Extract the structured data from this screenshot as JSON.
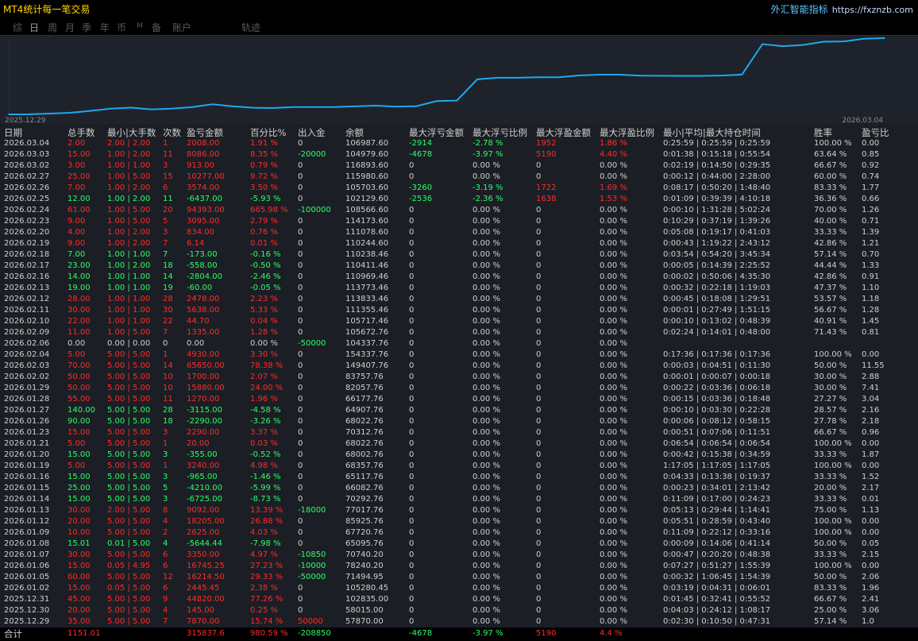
{
  "app": {
    "title": "MT4统计每一笔交易",
    "brand": "外汇智能指标",
    "url": "https://fxznzb.com"
  },
  "tabs": [
    {
      "id": "zong",
      "label": "综",
      "active": false
    },
    {
      "id": "ri",
      "label": "日",
      "active": true
    },
    {
      "id": "zhou",
      "label": "周",
      "active": false
    },
    {
      "id": "yue",
      "label": "月",
      "active": false
    },
    {
      "id": "ji",
      "label": "季",
      "active": false
    },
    {
      "id": "nian",
      "label": "年",
      "active": false
    },
    {
      "id": "bi",
      "label": "币",
      "active": false
    },
    {
      "id": "m",
      "label": "M",
      "active": false,
      "small": true
    },
    {
      "id": "bei",
      "label": "备",
      "active": false
    },
    {
      "id": "zhanghu",
      "label": "账户",
      "active": false
    },
    {
      "id": "guiji",
      "label": "轨迹",
      "active": false
    }
  ],
  "colors": {
    "up": "#2bff6a",
    "down": "#ff2b2b",
    "neutral": "#d0d0d0",
    "line": "#1ea8ef",
    "chart_bg": "#1e222a"
  },
  "chart_data": {
    "type": "line",
    "x_start": "2025.12.29",
    "x_end": "2026.03.04",
    "x": [
      "2025.12.29",
      "2025.12.30",
      "2025.12.31",
      "2026.01.02",
      "2026.01.05",
      "2026.01.06",
      "2026.01.07",
      "2026.01.08",
      "2026.01.09",
      "2026.01.12",
      "2026.01.13",
      "2026.01.14",
      "2026.01.15",
      "2026.01.16",
      "2026.01.19",
      "2026.01.20",
      "2026.01.21",
      "2026.01.23",
      "2026.01.26",
      "2026.01.27",
      "2026.01.28",
      "2026.01.29",
      "2026.02.02",
      "2026.02.03",
      "2026.02.04",
      "2026.02.06",
      "2026.02.09",
      "2026.02.10",
      "2026.02.11",
      "2026.02.12",
      "2026.02.13",
      "2026.02.16",
      "2026.02.17",
      "2026.02.18",
      "2026.02.19",
      "2026.02.20",
      "2026.02.23",
      "2026.02.24",
      "2026.02.25",
      "2026.02.26",
      "2026.02.27",
      "2026.03.02",
      "2026.03.03",
      "2026.03.04"
    ],
    "values": [
      57870,
      58015,
      102835,
      105280.45,
      71494.95,
      78240.2,
      70740.2,
      65095.76,
      67720.76,
      85925.76,
      77017.76,
      70292.76,
      66082.76,
      65117.76,
      68357.76,
      68002.76,
      68022.76,
      70312.76,
      68022.76,
      64907.76,
      66177.76,
      82057.76,
      83757.76,
      149407.76,
      154337.76,
      104337.76,
      105672.76,
      105717.46,
      111355.46,
      113833.46,
      113773.46,
      110969.46,
      110411.46,
      110238.46,
      110244.6,
      111078.6,
      114173.6,
      108566.6,
      102129.6,
      105703.6,
      115980.6,
      116893.6,
      104979.6,
      106987.6
    ],
    "plot_values": [
      0,
      145,
      2580,
      5025,
      10845,
      17591,
      20941,
      15296,
      17922,
      22422,
      31514,
      24789,
      20579,
      19614,
      22854,
      22499,
      22519,
      24809,
      27099,
      23984,
      25254,
      41134,
      42834,
      108484,
      113414,
      113414,
      114749,
      114794,
      120432,
      122910,
      122850,
      120046,
      119488,
      119315,
      119321,
      120155,
      123250,
      217643,
      211206,
      214780,
      225057,
      225970,
      234006,
      236014
    ],
    "ylim": [
      0,
      236014
    ]
  },
  "columns": [
    "日期",
    "总手数",
    "最小|大手数",
    "次数",
    "盈亏金额",
    "百分比%",
    "出入金",
    "余额",
    "最大浮亏金额",
    "最大浮亏比例",
    "最大浮盈金额",
    "最大浮盈比例",
    "最小|平均|最大持仓时间",
    "胜率",
    "盈亏比"
  ],
  "rows": [
    [
      "2026.03.04",
      "2.00",
      "2.00 | 2.00",
      "1",
      "2008.00",
      "1.91 %",
      "0",
      "106987.60",
      "-2914",
      "-2.78 %",
      "1952",
      "1.86 %",
      "0:25:59 | 0:25:59 | 0:25:59",
      "100.00 %",
      "0.00"
    ],
    [
      "2026.03.03",
      "15.00",
      "1.00 | 2.00",
      "11",
      "8086.00",
      "8.35 %",
      "-20000",
      "104979.60",
      "-4678",
      "-3.97 %",
      "5190",
      "4.40 %",
      "0:01:38 | 0:15:18 | 0:55:54",
      "63.64 %",
      "0.85"
    ],
    [
      "2026.03.02",
      "3.00",
      "1.00 | 1.00",
      "3",
      "913.00",
      "0.79 %",
      "0",
      "116893.60",
      "0",
      "0.00 %",
      "0",
      "0.00 %",
      "0:02:19 | 0:14:50 | 0:29:35",
      "66.67 %",
      "0.92"
    ],
    [
      "2026.02.27",
      "25.00",
      "1.00 | 5.00",
      "15",
      "10277.00",
      "9.72 %",
      "0",
      "115980.60",
      "0",
      "0.00 %",
      "0",
      "0.00 %",
      "0:00:12 | 0:44:00 | 2:28:00",
      "60.00 %",
      "0.74"
    ],
    [
      "2026.02.26",
      "7.00",
      "1.00 | 2.00",
      "6",
      "3574.00",
      "3.50 %",
      "0",
      "105703.60",
      "-3260",
      "-3.19 %",
      "1722",
      "1.69 %",
      "0:08:17 | 0:50:20 | 1:48:40",
      "83.33 %",
      "1.77"
    ],
    [
      "2026.02.25",
      "12.00",
      "1.00 | 2.00",
      "11",
      "-6437.00",
      "-5.93 %",
      "0",
      "102129.60",
      "-2536",
      "-2.36 %",
      "1638",
      "1.53 %",
      "0:01:09 | 0:39:39 | 4:10:18",
      "36.36 %",
      "0.66"
    ],
    [
      "2026.02.24",
      "61.00",
      "1.00 | 5.00",
      "20",
      "94393.00",
      "665.98 %",
      "-100000",
      "108566.60",
      "0",
      "0.00 %",
      "0",
      "0.00 %",
      "0:00:10 | 1:31:28 | 5:02:24",
      "70.00 %",
      "1.26"
    ],
    [
      "2026.02.23",
      "9.00",
      "1.00 | 5.00",
      "5",
      "3095.00",
      "2.79 %",
      "0",
      "114173.60",
      "0",
      "0.00 %",
      "0",
      "0.00 %",
      "0:10:29 | 0:37:19 | 1:39:26",
      "40.00 %",
      "0.71"
    ],
    [
      "2026.02.20",
      "4.00",
      "1.00 | 2.00",
      "3",
      "834.00",
      "0.76 %",
      "0",
      "111078.60",
      "0",
      "0.00 %",
      "0",
      "0.00 %",
      "0:05:08 | 0:19:17 | 0:41:03",
      "33.33 %",
      "1.39"
    ],
    [
      "2026.02.19",
      "9.00",
      "1.00 | 2.00",
      "7",
      "6.14",
      "0.01 %",
      "0",
      "110244.60",
      "0",
      "0.00 %",
      "0",
      "0.00 %",
      "0:00:43 | 1:19:22 | 2:43:12",
      "42.86 %",
      "1.21"
    ],
    [
      "2026.02.18",
      "7.00",
      "1.00 | 1.00",
      "7",
      "-173.00",
      "-0.16 %",
      "0",
      "110238.46",
      "0",
      "0.00 %",
      "0",
      "0.00 %",
      "0:03:54 | 0:54:20 | 3:45:34",
      "57.14 %",
      "0.70"
    ],
    [
      "2026.02.17",
      "23.00",
      "1.00 | 2.00",
      "18",
      "-558.00",
      "-0.50 %",
      "0",
      "110411.46",
      "0",
      "0.00 %",
      "0",
      "0.00 %",
      "0:00:05 | 0:14:39 | 2:25:52",
      "44.44 %",
      "1.33"
    ],
    [
      "2026.02.16",
      "14.00",
      "1.00 | 1.00",
      "14",
      "-2804.00",
      "-2.46 %",
      "0",
      "110969.46",
      "0",
      "0.00 %",
      "0",
      "0.00 %",
      "0:00:02 | 0:50:06 | 4:35:30",
      "42.86 %",
      "0.91"
    ],
    [
      "2026.02.13",
      "19.00",
      "1.00 | 1.00",
      "19",
      "-60.00",
      "-0.05 %",
      "0",
      "113773.46",
      "0",
      "0.00 %",
      "0",
      "0.00 %",
      "0:00:32 | 0:22:18 | 1:19:03",
      "47.37 %",
      "1.10"
    ],
    [
      "2026.02.12",
      "28.00",
      "1.00 | 1.00",
      "28",
      "2478.00",
      "2.23 %",
      "0",
      "113833.46",
      "0",
      "0.00 %",
      "0",
      "0.00 %",
      "0:00:45 | 0:18:08 | 1:29:51",
      "53.57 %",
      "1.18"
    ],
    [
      "2026.02.11",
      "30.00",
      "1.00 | 1.00",
      "30",
      "5638.00",
      "5.33 %",
      "0",
      "111355.46",
      "0",
      "0.00 %",
      "0",
      "0.00 %",
      "0:00:01 | 0:27:49 | 1:51:15",
      "56.67 %",
      "1.28"
    ],
    [
      "2026.02.10",
      "22.00",
      "1.00 | 1.00",
      "22",
      "44.70",
      "0.04 %",
      "0",
      "105717.46",
      "0",
      "0.00 %",
      "0",
      "0.00 %",
      "0:00:10 | 0:13:02 | 0:48:39",
      "40.91 %",
      "1.45"
    ],
    [
      "2026.02.09",
      "11.00",
      "1.00 | 5.00",
      "7",
      "1335.00",
      "1.28 %",
      "0",
      "105672.76",
      "0",
      "0.00 %",
      "0",
      "0.00 %",
      "0:02:24 | 0:14:01 | 0:48:00",
      "71.43 %",
      "0.81"
    ],
    [
      "2026.02.06",
      "0.00",
      "0.00 | 0.00",
      "0",
      "0.00",
      "0.00 %",
      "-50000",
      "104337.76",
      "0",
      "0.00 %",
      "0",
      "0.00 %",
      "",
      "",
      ""
    ],
    [
      "2026.02.04",
      "5.00",
      "5.00 | 5.00",
      "1",
      "4930.00",
      "3.30 %",
      "0",
      "154337.76",
      "0",
      "0.00 %",
      "0",
      "0.00 %",
      "0:17:36 | 0:17:36 | 0:17:36",
      "100.00 %",
      "0.00"
    ],
    [
      "2026.02.03",
      "70.00",
      "5.00 | 5.00",
      "14",
      "65650.00",
      "78.38 %",
      "0",
      "149407.76",
      "0",
      "0.00 %",
      "0",
      "0.00 %",
      "0:00:03 | 0:04:51 | 0:11:30",
      "50.00 %",
      "11.55"
    ],
    [
      "2026.02.02",
      "50.00",
      "5.00 | 5.00",
      "10",
      "1700.00",
      "2.07 %",
      "0",
      "83757.76",
      "0",
      "0.00 %",
      "0",
      "0.00 %",
      "0:00:01 | 0:00:07 | 0:00:18",
      "30.00 %",
      "2.88"
    ],
    [
      "2026.01.29",
      "50.00",
      "5.00 | 5.00",
      "10",
      "15880.00",
      "24.00 %",
      "0",
      "82057.76",
      "0",
      "0.00 %",
      "0",
      "0.00 %",
      "0:00:22 | 0:03:36 | 0:06:18",
      "30.00 %",
      "7.41"
    ],
    [
      "2026.01.28",
      "55.00",
      "5.00 | 5.00",
      "11",
      "1270.00",
      "1.96 %",
      "0",
      "66177.76",
      "0",
      "0.00 %",
      "0",
      "0.00 %",
      "0:00:15 | 0:03:36 | 0:18:48",
      "27.27 %",
      "3.04"
    ],
    [
      "2026.01.27",
      "140.00",
      "5.00 | 5.00",
      "28",
      "-3115.00",
      "-4.58 %",
      "0",
      "64907.76",
      "0",
      "0.00 %",
      "0",
      "0.00 %",
      "0:00:10 | 0:03:30 | 0:22:28",
      "28.57 %",
      "2.16"
    ],
    [
      "2026.01.26",
      "90.00",
      "5.00 | 5.00",
      "18",
      "-2290.00",
      "-3.26 %",
      "0",
      "68022.76",
      "0",
      "0.00 %",
      "0",
      "0.00 %",
      "0:00:06 | 0:08:12 | 0:58:15",
      "27.78 %",
      "2.18"
    ],
    [
      "2026.01.23",
      "15.00",
      "5.00 | 5.00",
      "3",
      "2290.00",
      "3.37 %",
      "0",
      "70312.76",
      "0",
      "0.00 %",
      "0",
      "0.00 %",
      "0:00:51 | 0:07:06 | 0:11:51",
      "66.67 %",
      "0.96"
    ],
    [
      "2026.01.21",
      "5.00",
      "5.00 | 5.00",
      "1",
      "20.00",
      "0.03 %",
      "0",
      "68022.76",
      "0",
      "0.00 %",
      "0",
      "0.00 %",
      "0:06:54 | 0:06:54 | 0:06:54",
      "100.00 %",
      "0.00"
    ],
    [
      "2026.01.20",
      "15.00",
      "5.00 | 5.00",
      "3",
      "-355.00",
      "-0.52 %",
      "0",
      "68002.76",
      "0",
      "0.00 %",
      "0",
      "0.00 %",
      "0:00:42 | 0:15:38 | 0:34:59",
      "33.33 %",
      "1.87"
    ],
    [
      "2026.01.19",
      "5.00",
      "5.00 | 5.00",
      "1",
      "3240.00",
      "4.98 %",
      "0",
      "68357.76",
      "0",
      "0.00 %",
      "0",
      "0.00 %",
      "1:17:05 | 1:17:05 | 1:17:05",
      "100.00 %",
      "0.00"
    ],
    [
      "2026.01.16",
      "15.00",
      "5.00 | 5.00",
      "3",
      "-965.00",
      "-1.46 %",
      "0",
      "65117.76",
      "0",
      "0.00 %",
      "0",
      "0.00 %",
      "0:04:33 | 0:13:38 | 0:19:37",
      "33.33 %",
      "1.52"
    ],
    [
      "2026.01.15",
      "25.00",
      "5.00 | 5.00",
      "5",
      "-4210.00",
      "-5.99 %",
      "0",
      "66082.76",
      "0",
      "0.00 %",
      "0",
      "0.00 %",
      "0:00:23 | 0:34:01 | 2:13:42",
      "20.00 %",
      "2.17"
    ],
    [
      "2026.01.14",
      "15.00",
      "5.00 | 5.00",
      "3",
      "-6725.00",
      "-8.73 %",
      "0",
      "70292.76",
      "0",
      "0.00 %",
      "0",
      "0.00 %",
      "0:11:09 | 0:17:00 | 0:24:23",
      "33.33 %",
      "0.01"
    ],
    [
      "2026.01.13",
      "30.00",
      "2.00 | 5.00",
      "8",
      "9092.00",
      "13.39 %",
      "-18000",
      "77017.76",
      "0",
      "0.00 %",
      "0",
      "0.00 %",
      "0:05:13 | 0:29:44 | 1:14:41",
      "75.00 %",
      "1.13"
    ],
    [
      "2026.01.12",
      "20.00",
      "5.00 | 5.00",
      "4",
      "18205.00",
      "26.88 %",
      "0",
      "85925.76",
      "0",
      "0.00 %",
      "0",
      "0.00 %",
      "0:05:51 | 0:28:59 | 0:43:40",
      "100.00 %",
      "0.00"
    ],
    [
      "2026.01.09",
      "10.00",
      "5.00 | 5.00",
      "2",
      "2625.00",
      "4.03 %",
      "0",
      "67720.76",
      "0",
      "0.00 %",
      "0",
      "0.00 %",
      "0:11:09 | 0:22:12 | 0:33:16",
      "100.00 %",
      "0.00"
    ],
    [
      "2026.01.08",
      "15.01",
      "0.01 | 5.00",
      "4",
      "-5644.44",
      "-7.98 %",
      "0",
      "65095.76",
      "0",
      "0.00 %",
      "0",
      "0.00 %",
      "0:00:09 | 0:14:06 | 0:41:14",
      "50.00 %",
      "0.05"
    ],
    [
      "2026.01.07",
      "30.00",
      "5.00 | 5.00",
      "6",
      "3350.00",
      "4.97 %",
      "-10850",
      "70740.20",
      "0",
      "0.00 %",
      "0",
      "0.00 %",
      "0:00:47 | 0:20:20 | 0:48:38",
      "33.33 %",
      "2.15"
    ],
    [
      "2026.01.06",
      "15.00",
      "0.05 | 4.95",
      "6",
      "16745.25",
      "27.23 %",
      "-10000",
      "78240.20",
      "0",
      "0.00 %",
      "0",
      "0.00 %",
      "0:07:27 | 0:51:27 | 1:55:39",
      "100.00 %",
      "0.00"
    ],
    [
      "2026.01.05",
      "60.00",
      "5.00 | 5.00",
      "12",
      "16214.50",
      "29.33 %",
      "-50000",
      "71494.95",
      "0",
      "0.00 %",
      "0",
      "0.00 %",
      "0:00:32 | 1:06:45 | 1:54:39",
      "50.00 %",
      "2.06"
    ],
    [
      "2026.01.02",
      "15.00",
      "0.05 | 5.00",
      "6",
      "2445.45",
      "2.38 %",
      "0",
      "105280.45",
      "0",
      "0.00 %",
      "0",
      "0.00 %",
      "0:03:19 | 0:04:31 | 0:06:01",
      "83.33 %",
      "1.96"
    ],
    [
      "2025.12.31",
      "45.00",
      "5.00 | 5.00",
      "9",
      "44820.00",
      "77.26 %",
      "0",
      "102835.00",
      "0",
      "0.00 %",
      "0",
      "0.00 %",
      "0:01:45 | 0:32:41 | 0:55:52",
      "66.67 %",
      "2.41"
    ],
    [
      "2025.12.30",
      "20.00",
      "5.00 | 5.00",
      "4",
      "145.00",
      "0.25 %",
      "0",
      "58015.00",
      "0",
      "0.00 %",
      "0",
      "0.00 %",
      "0:04:03 | 0:24:12 | 1:08:17",
      "25.00 %",
      "3.06"
    ],
    [
      "2025.12.29",
      "35.00",
      "5.00 | 5.00",
      "7",
      "7870.00",
      "15.74 %",
      "50000",
      "57870.00",
      "0",
      "0.00 %",
      "0",
      "0.00 %",
      "0:02:30 | 0:10:50 | 0:47:31",
      "57.14 %",
      "1.0"
    ]
  ],
  "row_colors": [
    "r",
    "r",
    "r",
    "r",
    "r",
    "g",
    "r",
    "r",
    "r",
    "r",
    "g",
    "g",
    "g",
    "g",
    "r",
    "r",
    "r",
    "r",
    "w",
    "r",
    "r",
    "r",
    "r",
    "r",
    "g",
    "g",
    "r",
    "r",
    "g",
    "r",
    "g",
    "g",
    "g",
    "r",
    "r",
    "r",
    "g",
    "r",
    "r",
    "r",
    "r",
    "r",
    "r",
    "r"
  ],
  "totals": [
    "合计",
    "1151.01",
    "",
    "",
    "315837.6",
    "980.59 %",
    "-208850",
    "",
    "-4678",
    "-3.97 %",
    "5190",
    "4.4 %",
    "",
    "",
    ""
  ]
}
